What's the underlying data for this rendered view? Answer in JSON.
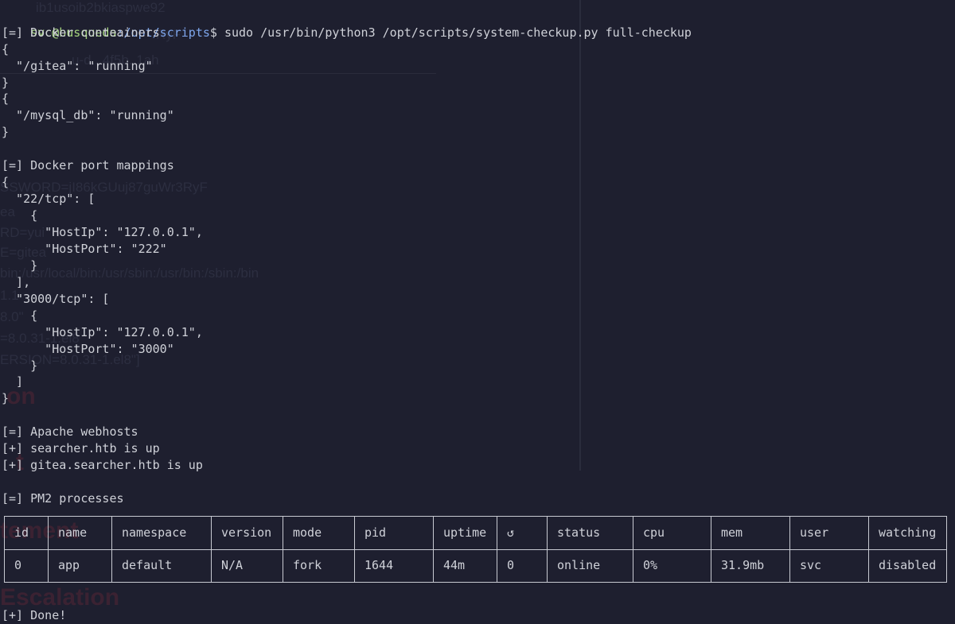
{
  "background_ghost_text": [
    "ib1usoib2bkiaspwe92",
    "RyF",
    "u-d...4f5b..1ah",
    "SSWORD=jI86kGUuj87guWr3RyF",
    "ea",
    "RD=yui",
    "E=gitea",
    "bin:/usr/local/bin:/usr/sbin:/usr/bin:/sbin:/bin",
    "1.1",
    "8.0\"",
    "=8.0.31-1.el8",
    "ERSION=8.0.31-1.el8\"]",
    "on",
    "t",
    "tement",
    "Escalation"
  ],
  "prompt": {
    "user_host": "svc@busqueda",
    "path": ":/opt/scripts",
    "command": "$ sudo /usr/bin/python3 /opt/scripts/system-checkup.py full-checkup"
  },
  "output_lines": [
    "[=] Docker conteainers",
    "{",
    "  \"/gitea\": \"running\"",
    "}",
    "{",
    "  \"/mysql_db\": \"running\"",
    "}",
    "",
    "[=] Docker port mappings",
    "{",
    "  \"22/tcp\": [",
    "    {",
    "      \"HostIp\": \"127.0.0.1\",",
    "      \"HostPort\": \"222\"",
    "    }",
    "  ],",
    "  \"3000/tcp\": [",
    "    {",
    "      \"HostIp\": \"127.0.0.1\",",
    "      \"HostPort\": \"3000\"",
    "    }",
    "  ]",
    "}",
    "",
    "[=] Apache webhosts",
    "[+] searcher.htb is up",
    "[+] gitea.searcher.htb is up",
    "",
    "[=] PM2 processes"
  ],
  "pm2_table": {
    "columns": [
      "id",
      "name",
      "namespace",
      "version",
      "mode",
      "pid",
      "uptime",
      "↺",
      "status",
      "cpu",
      "mem",
      "user",
      "watching"
    ],
    "rows": [
      [
        "0",
        "app",
        "default",
        "N/A",
        "fork",
        "1644",
        "44m",
        "0",
        "online",
        "0%",
        "31.9mb",
        "svc",
        "disabled"
      ]
    ]
  },
  "done_line": "[+] Done!"
}
